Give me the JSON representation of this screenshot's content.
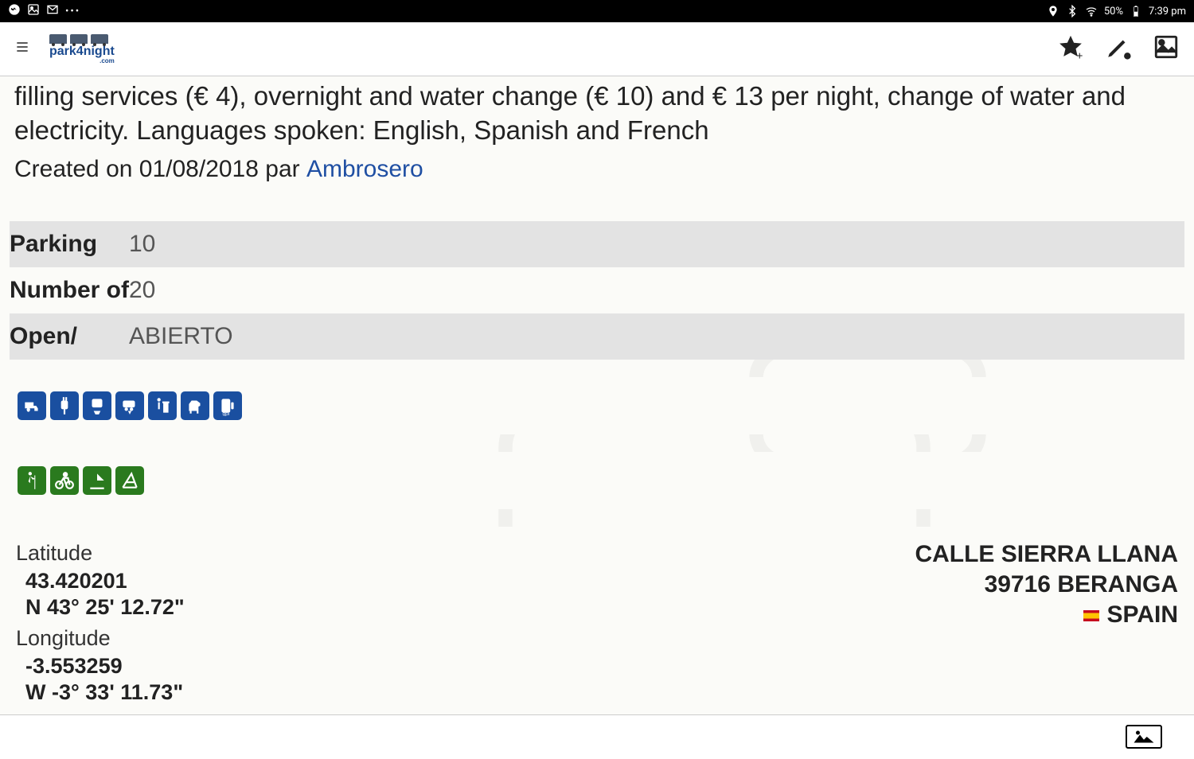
{
  "statusbar": {
    "battery": "50%",
    "time": "7:39 pm"
  },
  "appbar": {
    "brand_top": "",
    "brand": "park4night",
    "brand_sub": ".com"
  },
  "detail": {
    "description": "filling services (€ 4), overnight and water change (€ 10) and € 13 per night, change of water and electricity. Languages spoken: English, Spanish and French",
    "created_prefix": "Created on ",
    "created_date": "01/08/2018",
    "created_par": " par ",
    "author": "Ambrosero"
  },
  "info": [
    {
      "label": "Parking",
      "value": "10",
      "shade": true
    },
    {
      "label": "Number of",
      "value": "20",
      "shade": false
    },
    {
      "label": "Open/",
      "value": "ABIERTO",
      "shade": true
    }
  ],
  "service_icons": [
    "water-tap",
    "electric-plug",
    "wc-dump",
    "grey-water-dump",
    "trash-bin",
    "dog-allowed",
    "gpl-fuel"
  ],
  "activity_icons": [
    "hiking",
    "cycling",
    "windsurf",
    "playground"
  ],
  "coords": {
    "lat_label": "Latitude",
    "lat_dec": "43.420201",
    "lat_dms": "N 43° 25' 12.72\"",
    "lon_label": "Longitude",
    "lon_dec": "-3.553259",
    "lon_dms": "W -3° 33' 11.73\""
  },
  "address": {
    "street": "CALLE SIERRA LLANA",
    "city_zip": "39716 BERANGA",
    "country": "SPAIN"
  }
}
